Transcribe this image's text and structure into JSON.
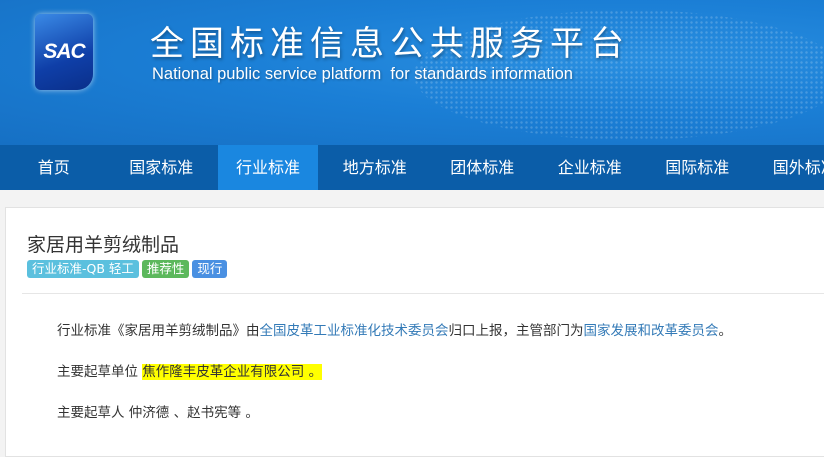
{
  "header": {
    "logo_text": "SAC",
    "title_cn": "全国标准信息公共服务平台",
    "title_en": "National public service platform  for standards information"
  },
  "nav": {
    "items": [
      "首页",
      "国家标准",
      "行业标准",
      "地方标准",
      "团体标准",
      "企业标准",
      "国际标准",
      "国外标准"
    ],
    "active_index": 2
  },
  "standard": {
    "title": "家居用羊剪绒制品",
    "tags": [
      {
        "label": "行业标准-QB 轻工",
        "color": "#5bc0de"
      },
      {
        "label": "推荐性",
        "color": "#5cb85c"
      },
      {
        "label": "现行",
        "color": "#4a90e2"
      }
    ],
    "desc_prefix": "行业标准《家居用羊剪绒制品》由",
    "committee_link": "全国皮革工业标准化技术委员会",
    "desc_mid": "归口上报，主管部门为",
    "authority_link": "国家发展和改革委员会",
    "desc_end": "。",
    "drafting_unit_label": "主要起草单位",
    "drafting_unit": "焦作隆丰皮革企业有限公司 。",
    "drafters_label": "主要起草人",
    "drafters": "仲济德 、赵书宪等 。"
  }
}
